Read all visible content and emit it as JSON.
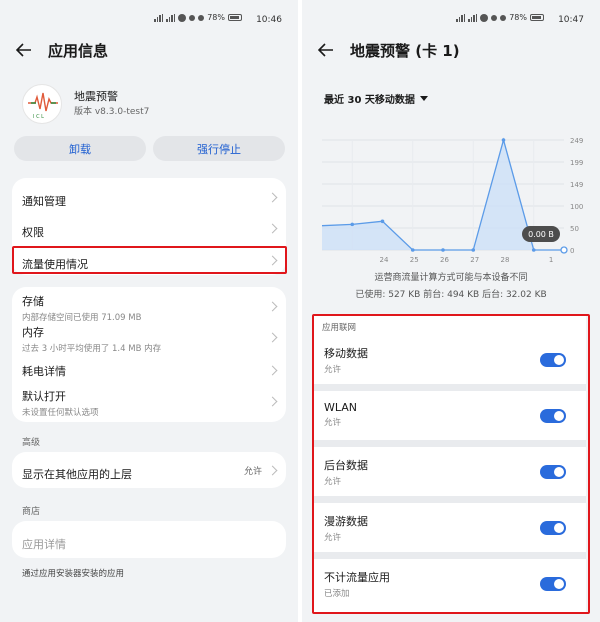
{
  "left": {
    "status": {
      "battery": "78%",
      "time": "10:46"
    },
    "title": "应用信息",
    "app": {
      "name": "地震预警",
      "version": "版本 v8.3.0-test7"
    },
    "buttons": {
      "uninstall": "卸载",
      "force_stop": "强行停止"
    },
    "card1": [
      "通知管理",
      "权限",
      "流量使用情况"
    ],
    "storage": {
      "label": "存储",
      "sub": "内部存储空间已使用 71.09 MB"
    },
    "memory": {
      "label": "内存",
      "sub": "过去 3 小时平均使用了 1.4 MB 内存"
    },
    "battery_usage": {
      "label": "耗电详情"
    },
    "default_open": {
      "label": "默认打开",
      "sub": "未设置任何默认选项"
    },
    "advanced_header": "高级",
    "overlay": {
      "label": "显示在其他应用的上层",
      "value": "允许"
    },
    "store_header": "商店",
    "app_details": "应用详情",
    "footnote": "通过应用安装器安装的应用"
  },
  "right": {
    "status": {
      "battery": "78%",
      "time": "10:47"
    },
    "title": "地震预警 (卡 1)",
    "period": "最近 30 天移动数据",
    "note": "运营商流量计算方式可能与本设备不同",
    "usage": "已使用: 527 KB 前台: 494 KB 后台: 32.02 KB",
    "section_header": "应用联网",
    "toggles": [
      {
        "label": "移动数据",
        "sub": "允许",
        "on": true
      },
      {
        "label": "WLAN",
        "sub": "允许",
        "on": true
      },
      {
        "label": "后台数据",
        "sub": "允许",
        "on": true
      },
      {
        "label": "漫游数据",
        "sub": "允许",
        "on": true
      },
      {
        "label": "不计流量应用",
        "sub": "已添加",
        "on": true
      }
    ]
  },
  "chart_data": {
    "type": "area",
    "x": [
      22,
      23,
      24,
      25,
      26,
      27,
      28,
      29,
      30
    ],
    "x_tick_labels": [
      "24",
      "25",
      "26",
      "27",
      "28",
      "1"
    ],
    "y_tick_labels": [
      "249",
      "199",
      "149",
      "100",
      "50",
      "0"
    ],
    "ylim": [
      0,
      249
    ],
    "series": [
      {
        "values": [
          55,
          58,
          65,
          0,
          0,
          0,
          249,
          0,
          0
        ]
      }
    ],
    "tooltip": "0.00 B",
    "grid": true,
    "color": "#5b9be8"
  }
}
